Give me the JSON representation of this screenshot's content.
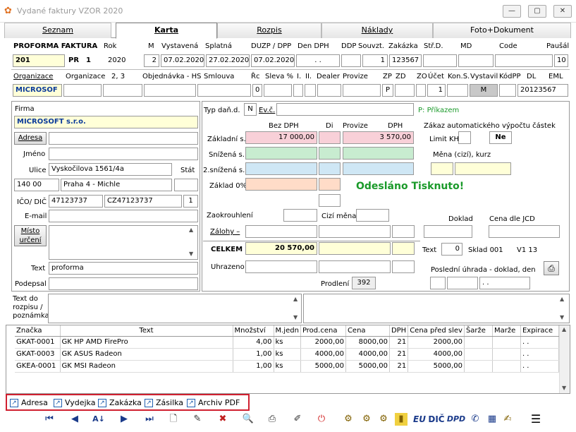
{
  "window": {
    "title": "Vydané faktury VZOR 2020",
    "min": "—",
    "max": "▢",
    "close": "✕"
  },
  "tabs": [
    {
      "label": "Seznam"
    },
    {
      "label": "Karta"
    },
    {
      "label": "Rozpis"
    },
    {
      "label": "Náklady"
    },
    {
      "label": "Foto+Dokument"
    }
  ],
  "header": {
    "doc_type": "PROFORMA FAKTURA",
    "lbl_rok": "Rok",
    "lbl_m": "M",
    "lbl_vystavena": "Vystavená",
    "lbl_splatna": "Splatná",
    "lbl_duzp": "DUZP / DPP",
    "lbl_den_dph": "Den DPH",
    "lbl_ddp": "DDP",
    "lbl_souvzt": "Souvzt.",
    "lbl_zakazka": "Zakázka",
    "lbl_strd": "Stř.D.",
    "lbl_md": "MD",
    "lbl_code": "Code",
    "lbl_pausal": "Paušál",
    "cislo": "201",
    "rada": "PR",
    "rada_num": "1",
    "rok": "2020",
    "m": "2",
    "vystavena": "07.02.2020",
    "splatna": "27.02.2020",
    "duzp": "07.02.2020",
    "den_dph": ". .",
    "souvzt": "1",
    "zakazka": "123567",
    "pausal": "10"
  },
  "row2": {
    "lbl_org": "Organizace",
    "lbl_org2": "Organizace",
    "lbl_23": "2,     3",
    "lbl_objednavka": "Objednávka - HS",
    "lbl_smlouva": "Smlouva",
    "lbl_rc": "Řc",
    "lbl_sleva": "Sleva %",
    "lbl_i": "I.",
    "lbl_ii": "II.",
    "lbl_dealer": "Dealer",
    "lbl_provize": "Provize",
    "lbl_zp": "ZP",
    "lbl_zd": "ZD",
    "lbl_zo": "ZO",
    "lbl_ucet": "Účet",
    "lbl_kons": "Kon.S.",
    "lbl_vystavil": "Vystavil",
    "lbl_kodpp": "KódPP",
    "lbl_dl": "DL",
    "lbl_eml": "EML",
    "org": "MICROSOF",
    "rc": "0",
    "zp": "P",
    "ucet": "1",
    "vystavil": "M",
    "eml": "20123567"
  },
  "firma": {
    "lbl_firma": "Firma",
    "name": "MICROSOFT s.r.o.",
    "btn_adresa": "Adresa",
    "lbl_jmeno": "Jméno",
    "lbl_ulice": "Ulice",
    "ulice": "Vyskočilova 1561/4a",
    "lbl_stat": "Stát",
    "psc": "140 00",
    "mesto": "Praha 4 - Michle",
    "lbl_ico": "IČO/ DIČ",
    "ico": "47123737",
    "dic": "CZ47123737",
    "ico_n": "1",
    "lbl_email": "E-mail",
    "btn_misto": "Místo určení",
    "lbl_text": "Text",
    "text": "proforma",
    "lbl_podpis": "Podepsal"
  },
  "dph": {
    "lbl_typ": "Typ daň.d.",
    "typ": "N",
    "lbl_evc": "Ev.č.",
    "prikaz": "P: Příkazem",
    "lbl_bez": "Bez DPH",
    "lbl_di": "Di",
    "lbl_provize": "Provize",
    "lbl_dph": "DPH",
    "lbl_zakladni": "Základní s.",
    "lbl_snizena": "Snížená s.",
    "lbl_snizena2": "2.snížená s.",
    "lbl_zaklad0": "Základ 0%",
    "zakladni_bez": "17 000,00",
    "zakladni_dph": "3 570,00",
    "zakaz": "Zákaz automatického výpočtu částek",
    "lbl_limit": "Limit KH",
    "ne": "Ne",
    "lbl_mena": "Měna (cizí), kurz",
    "status": "Odesláno Tisknuto!",
    "lbl_zaokr": "Zaokrouhlení",
    "lbl_cizi": "Cizí měna",
    "lbl_doklad": "Doklad",
    "lbl_cena_jcd": "Cena dle JCD",
    "lbl_zalohy": "Zálohy  –",
    "lbl_celkem": "CELKEM",
    "celkem": "20 570,00",
    "lbl_text": "Text",
    "text_n": "0",
    "sklad": "Sklad 001",
    "verze": "V1   13",
    "lbl_uhrazeno": "Uhrazeno",
    "lbl_posledni": "Poslední úhrada - doklad, den",
    "lbl_prodleni": "Prodlení",
    "prodleni": "392",
    "den": ". ."
  },
  "rozpis": {
    "label": "Text do rozpisu / poznámka"
  },
  "items": {
    "columns": [
      "Značka",
      "Text",
      "Množství",
      "M.jedn",
      "Prod.cena",
      "Cena",
      "DPH",
      "Cena před slev",
      "Šarže",
      "Marže",
      "Expirace"
    ],
    "rows": [
      [
        "GKAT-0001",
        "GK HP AMD FirePro",
        "4,00",
        "ks",
        "2000,00",
        "8000,00",
        "21",
        "2000,00",
        "",
        "",
        ". ."
      ],
      [
        "GKAT-0003",
        "GK ASUS Radeon",
        "1,00",
        "ks",
        "4000,00",
        "4000,00",
        "21",
        "4000,00",
        "",
        "",
        ". ."
      ],
      [
        "GKEA-0001",
        "GK MSI  Radeon",
        "1,00",
        "ks",
        "5000,00",
        "5000,00",
        "21",
        "5000,00",
        "",
        "",
        ". ."
      ]
    ]
  },
  "links": [
    {
      "label": "Adresa"
    },
    {
      "label": "Vydejka"
    },
    {
      "label": "Zakázka"
    },
    {
      "label": "Zásilka"
    },
    {
      "label": "Archiv PDF"
    }
  ],
  "toolbar": {
    "eu": "EU",
    "dic": "DIČ",
    "dpd": "DPD"
  },
  "colors": {
    "highlight_box": "#d02030",
    "status_green": "#1a9a2a",
    "yellow_field": "#ffffd8"
  }
}
